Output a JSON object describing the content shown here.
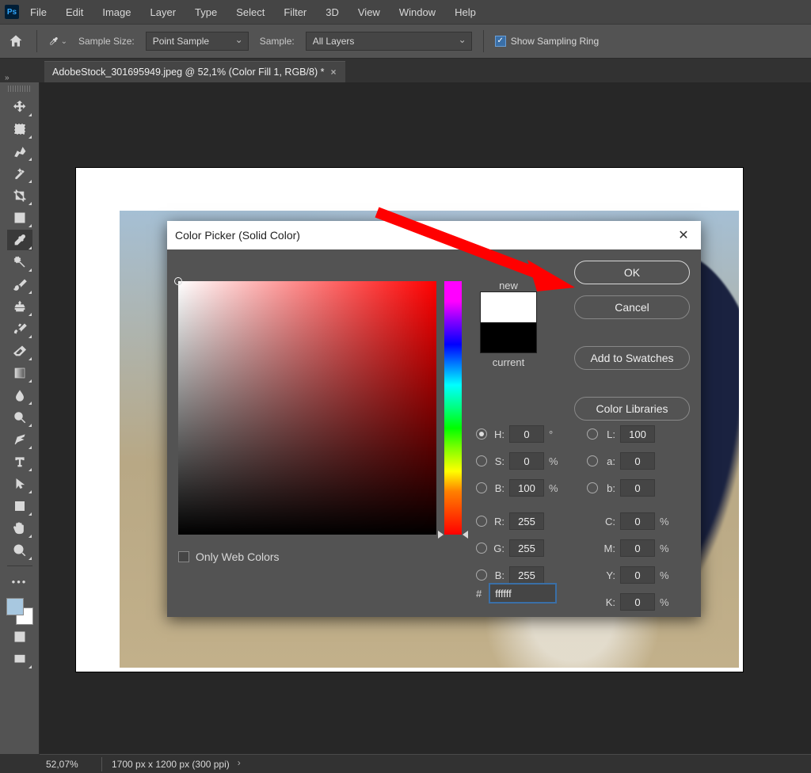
{
  "app": {
    "abbr": "Ps"
  },
  "menubar": [
    "File",
    "Edit",
    "Image",
    "Layer",
    "Type",
    "Select",
    "Filter",
    "3D",
    "View",
    "Window",
    "Help"
  ],
  "options": {
    "sample_size_label": "Sample Size:",
    "sample_size_value": "Point Sample",
    "sample_label": "Sample:",
    "sample_value": "All Layers",
    "show_sampling_ring": "Show Sampling Ring",
    "show_sampling_ring_checked": true
  },
  "tab": {
    "title": "AdobeStock_301695949.jpeg @ 52,1% (Color Fill 1, RGB/8) *"
  },
  "status": {
    "zoom": "52,07%",
    "doc_info": "1700 px x 1200 px (300 ppi)"
  },
  "dialog": {
    "title": "Color Picker (Solid Color)",
    "new_label": "new",
    "current_label": "current",
    "buttons": {
      "ok": "OK",
      "cancel": "Cancel",
      "add_swatches": "Add to Swatches",
      "color_libraries": "Color Libraries"
    },
    "only_web": "Only Web Colors",
    "deg": "°",
    "pct": "%",
    "hash": "#",
    "hex": "ffffff",
    "labels": {
      "H": "H:",
      "S": "S:",
      "Bv": "B:",
      "L": "L:",
      "a": "a:",
      "b": "b:",
      "R": "R:",
      "G": "G:",
      "Bb": "B:",
      "C": "C:",
      "M": "M:",
      "Y": "Y:",
      "K": "K:"
    },
    "values": {
      "H": "0",
      "S": "0",
      "Bv": "100",
      "L": "100",
      "a": "0",
      "b": "0",
      "R": "255",
      "G": "255",
      "Bb": "255",
      "C": "0",
      "M": "0",
      "Y": "0",
      "K": "0"
    }
  },
  "toolbox": [
    "move-tool",
    "marquee-tool",
    "lasso-tool",
    "magic-wand-tool",
    "crop-tool",
    "frame-tool",
    "eyedropper-tool",
    "spot-healing-tool",
    "brush-tool",
    "clone-stamp-tool",
    "history-brush-tool",
    "eraser-tool",
    "gradient-tool",
    "blur-tool",
    "dodge-tool",
    "pen-tool",
    "type-tool",
    "path-select-tool",
    "rectangle-tool",
    "hand-tool",
    "zoom-tool"
  ]
}
